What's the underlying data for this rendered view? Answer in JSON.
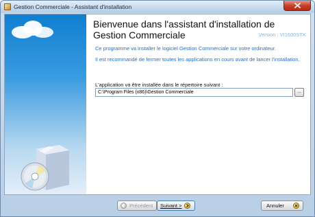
{
  "window": {
    "title": "Gestion Commerciale - Assistant d'installation"
  },
  "header": {
    "title": "Bienvenue dans l'assistant d'installation de Gestion Commerciale",
    "version": "Version : VI1600STK"
  },
  "body": {
    "intro": "Ce programme va installer le logiciel Gestion Commerciale sur votre ordinateur.",
    "recommendation": "Il est recommandé de fermer toutes les applications en cours avant de lancer l'installation.",
    "directory_label": "L'application va être installée dans le répertoire suivant :",
    "directory_value": "C:\\Program Files (x86)\\Gestion Commerciale",
    "browse_label": "..."
  },
  "buttons": {
    "previous_label": "Précédent",
    "next_label": "Suivant >",
    "cancel_label": "Annuler"
  },
  "colors": {
    "accent_text": "#2a6fc4",
    "close_button": "#c8412a"
  },
  "icons": {
    "app": "app-icon",
    "close": "close-icon",
    "previous": "arrow-left-icon",
    "next": "arrow-right-icon",
    "cancel": "cancel-icon"
  }
}
